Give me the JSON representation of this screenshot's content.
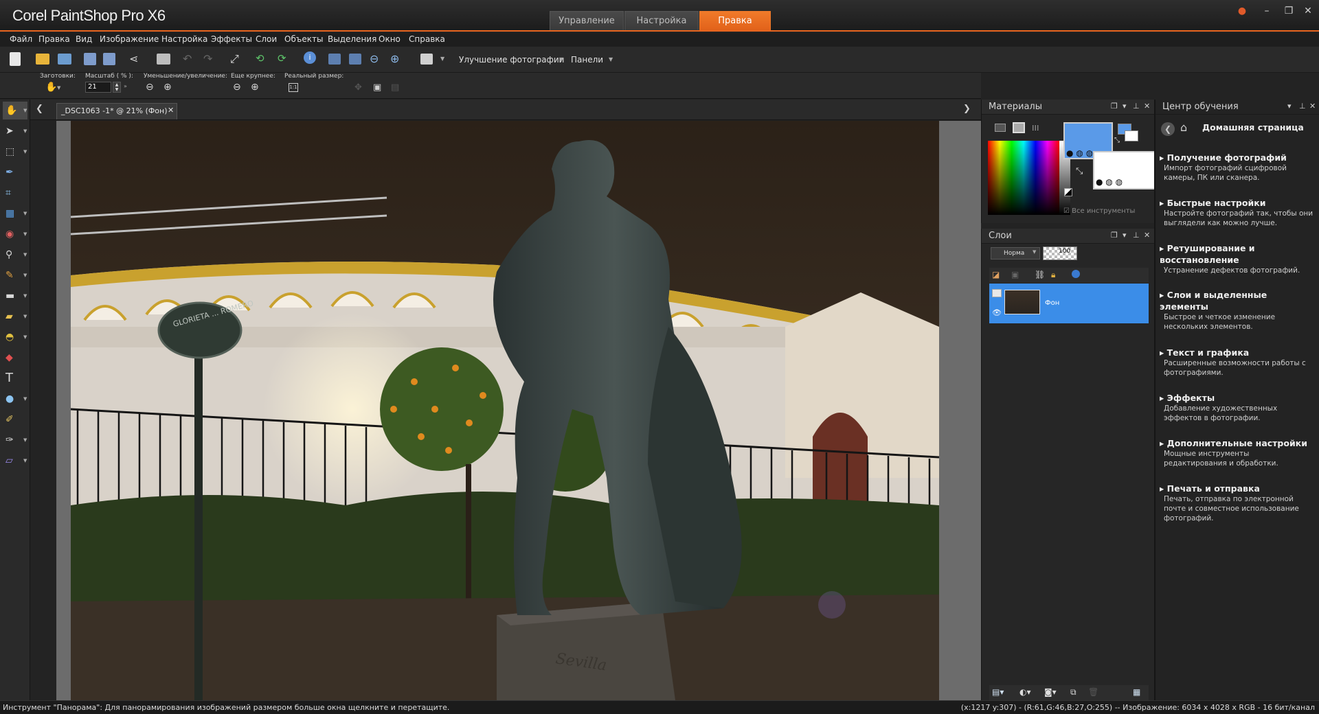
{
  "app": {
    "title": "Corel PaintShop Pro X6"
  },
  "workspace_tabs": [
    {
      "label": "Управление",
      "active": false
    },
    {
      "label": "Настройка",
      "active": false
    },
    {
      "label": "Правка",
      "active": true
    }
  ],
  "menu": [
    "Файл",
    "Правка",
    "Вид",
    "Изображение",
    "Настройка",
    "Эффекты",
    "Слои",
    "Объекты",
    "Выделения",
    "Окно",
    "Справка"
  ],
  "toolbar1": {
    "enhance_label": "Улучшение фотографии",
    "panels_label": "Панели"
  },
  "toolbar2": {
    "presets_label": "Заготовки:",
    "zoom_label": "Масштаб ( % ):",
    "zoom_value": "21",
    "zoom_inout_label": "Уменьшение/увеличение:",
    "zoom_more_label": "Еще крупнее:",
    "actual_size_label": "Реальный размер:"
  },
  "document": {
    "tab_label": "_DSC1063 -1* @  21% (Фон)"
  },
  "materials": {
    "title": "Материалы",
    "all_tools_label": "Все инструменты",
    "fg_color": "#5a9ae8",
    "bg_color": "#ffffff"
  },
  "layers": {
    "title": "Слои",
    "blend_mode": "Норма",
    "opacity": "100",
    "layer_name": "Фон"
  },
  "learning": {
    "title": "Центр обучения",
    "home_label": "Домашняя страница",
    "items": [
      {
        "title": "Получение фотографий",
        "desc": "Импорт фотографий сцифровой камеры, ПК или сканера."
      },
      {
        "title": "Быстрые настройки",
        "desc": "Настройте фотографий так, чтобы они выглядели как можно лучше."
      },
      {
        "title": "Ретуширование и восстановление",
        "desc": "Устранение дефектов фотографий."
      },
      {
        "title": "Слои и выделенные элементы",
        "desc": "Быстрое и четкое изменение нескольких элементов."
      },
      {
        "title": "Текст и графика",
        "desc": "Расширенные возможности работы с фотографиями."
      },
      {
        "title": "Эффекты",
        "desc": "Добавление художественных эффектов в фотографии."
      },
      {
        "title": "Дополнительные настройки",
        "desc": "Мощные инструменты редактирования и обработки."
      },
      {
        "title": "Печать и отправка",
        "desc": "Печать, отправка по электронной почте и совместное использование фотографий."
      }
    ]
  },
  "photo": {
    "sign_text": "GLORIETA ... ROMERO",
    "plinth_text": "Sevilla"
  },
  "status": {
    "left": "Инструмент \"Панорама\": Для панорамирования изображений размером больше окна щелкните и перетащите.",
    "right": "(x:1217 y:307) - (R:61,G:46,B:27,O:255) -- Изображение:  6034 x 4028 x RGB - 16 бит/канал"
  },
  "colors": {
    "accent": "#e8651f",
    "selected_layer": "#3b8de8"
  }
}
